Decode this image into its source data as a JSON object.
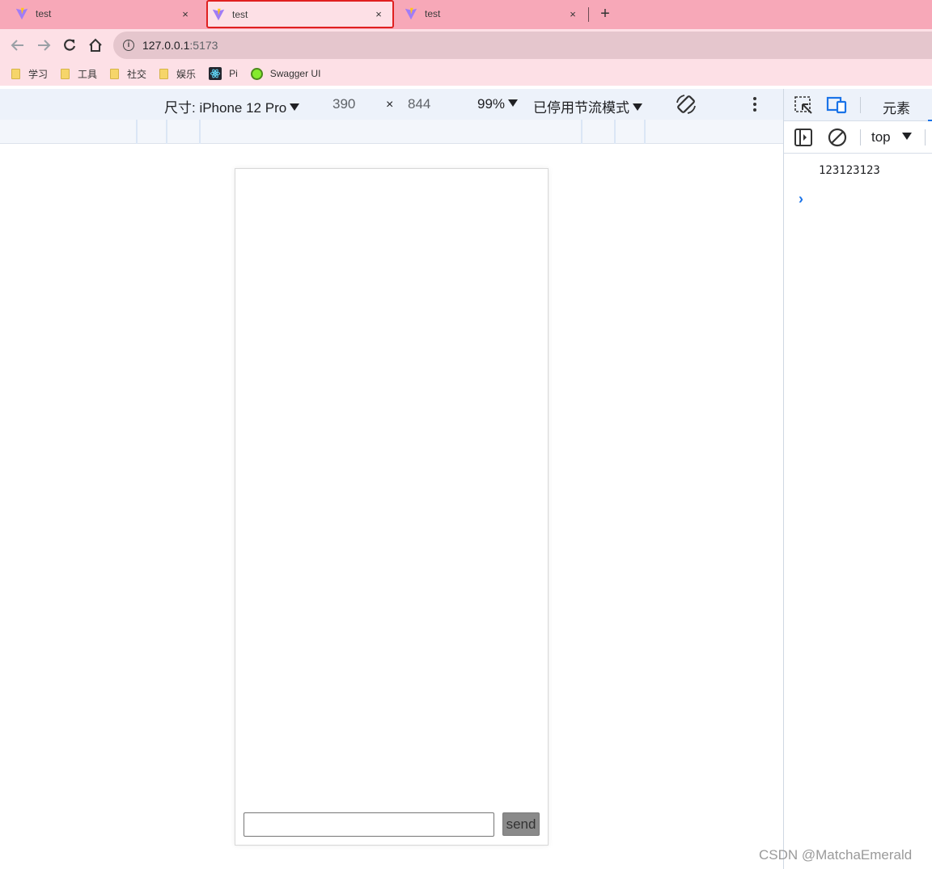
{
  "tabs": [
    {
      "title": "test",
      "close": "×"
    },
    {
      "title": "test",
      "close": "×"
    },
    {
      "title": "test",
      "close": "×"
    }
  ],
  "newtab": "+",
  "omnibox": {
    "host": "127.0.0.1",
    "port": ":5173"
  },
  "bookmarks": [
    {
      "label": "学习",
      "icon": "folder-icon"
    },
    {
      "label": "工具",
      "icon": "folder-icon"
    },
    {
      "label": "社交",
      "icon": "folder-icon"
    },
    {
      "label": "娱乐",
      "icon": "folder-icon"
    },
    {
      "label": "Pi",
      "icon": "react-icon"
    },
    {
      "label": "Swagger UI",
      "icon": "swagger-icon"
    }
  ],
  "device_toolbar": {
    "dimensions_label": "尺寸: iPhone 12 Pro",
    "width": "390",
    "times": "×",
    "height": "844",
    "zoom": "99%",
    "throttle": "已停用节流模式"
  },
  "app": {
    "send_label": "send",
    "input_value": ""
  },
  "devtools": {
    "elements_tab": "元素",
    "context": "top",
    "console_log": "123123123",
    "prompt": "›"
  },
  "watermark": "CSDN @MatchaEmerald",
  "colors": {
    "tabstrip": "#f7a8b8",
    "toolbar": "#fde0e6",
    "active_tab_border": "#e02020",
    "devtools_blue": "#1a73e8"
  }
}
